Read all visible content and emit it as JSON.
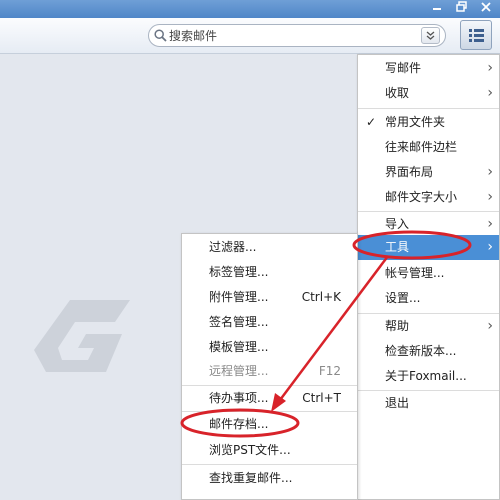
{
  "search": {
    "placeholder": "搜索邮件"
  },
  "main_menu": {
    "items": [
      {
        "label": "写邮件",
        "submenu": true
      },
      {
        "label": "收取",
        "submenu": true
      },
      {
        "label": "常用文件夹",
        "checked": true
      },
      {
        "label": "往来邮件边栏"
      },
      {
        "label": "界面布局",
        "submenu": true
      },
      {
        "label": "邮件文字大小",
        "submenu": true
      },
      {
        "label": "导入",
        "submenu": true
      },
      {
        "label": "工具",
        "submenu": true,
        "highlighted": true
      },
      {
        "label": "帐号管理..."
      },
      {
        "label": "设置..."
      },
      {
        "label": "帮助",
        "submenu": true
      },
      {
        "label": "检查新版本..."
      },
      {
        "label": "关于Foxmail..."
      },
      {
        "label": "退出"
      }
    ]
  },
  "tools_submenu": {
    "items": [
      {
        "label": "过滤器..."
      },
      {
        "label": "标签管理..."
      },
      {
        "label": "附件管理...",
        "shortcut": "Ctrl+K"
      },
      {
        "label": "签名管理..."
      },
      {
        "label": "模板管理..."
      },
      {
        "label": "远程管理...",
        "shortcut": "F12",
        "disabled": true
      },
      {
        "label": "待办事项...",
        "shortcut": "Ctrl+T"
      },
      {
        "label": "邮件存档...",
        "circled": true
      },
      {
        "label": "浏览PST文件..."
      },
      {
        "label": "查找重复邮件..."
      }
    ]
  },
  "colors": {
    "titlebar": "#4f86c8",
    "highlight": "#4a8fd6",
    "annotation": "#d8232a",
    "logo": "#cdd2da"
  },
  "icons": {
    "minimize": "minimize-icon",
    "restore": "restore-icon",
    "close": "close-icon",
    "search": "search-icon",
    "dropdown": "chevron-down-icon",
    "menu": "menu-list-icon",
    "logo": "foxmail-logo"
  }
}
